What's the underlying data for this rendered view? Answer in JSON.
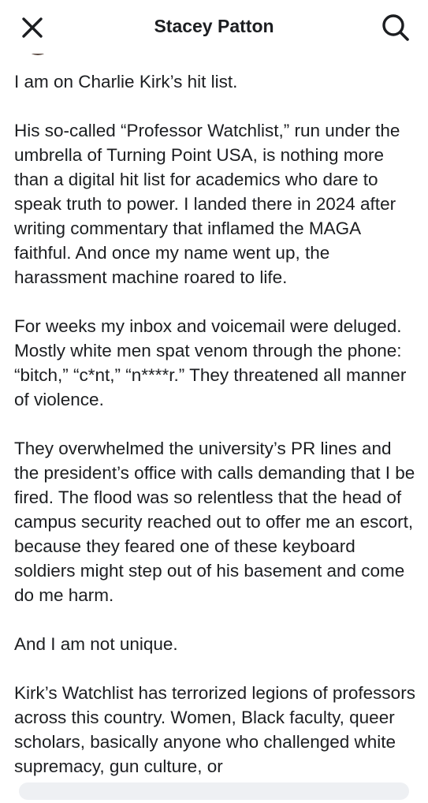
{
  "header": {
    "title": "Stacey Patton",
    "close_icon": "close-icon",
    "search_icon": "search-icon"
  },
  "post": {
    "paragraphs": [
      "I am on Charlie Kirk’s hit list.",
      "His so-called “Professor Watchlist,” run under the umbrella of Turning Point USA, is nothing more than a digital hit list for academics who dare to speak truth to power. I landed there in 2024 after writing commentary that inflamed the MAGA faithful. And once my name went up, the harassment machine roared to life.",
      "For weeks my inbox and voicemail were deluged. Mostly white men spat venom through the phone: “bitch,” “c*nt,” “n****r.” They threatened all manner of violence.",
      "They overwhelmed the university’s PR lines and the president’s office with calls demanding that I be fired. The flood was so relentless that the head of campus security reached out to offer me an escort, because they feared one of these keyboard soldiers might step out of his basement and come do me harm.",
      "And I am not unique.",
      "Kirk’s Watchlist has terrorized legions of professors across this country. Women, Black faculty, queer scholars, basically anyone who challenged white supremacy, gun culture, or"
    ]
  },
  "colors": {
    "text": "#1c1e21",
    "background": "#ffffff",
    "bottom_bar": "#eef0f3"
  }
}
